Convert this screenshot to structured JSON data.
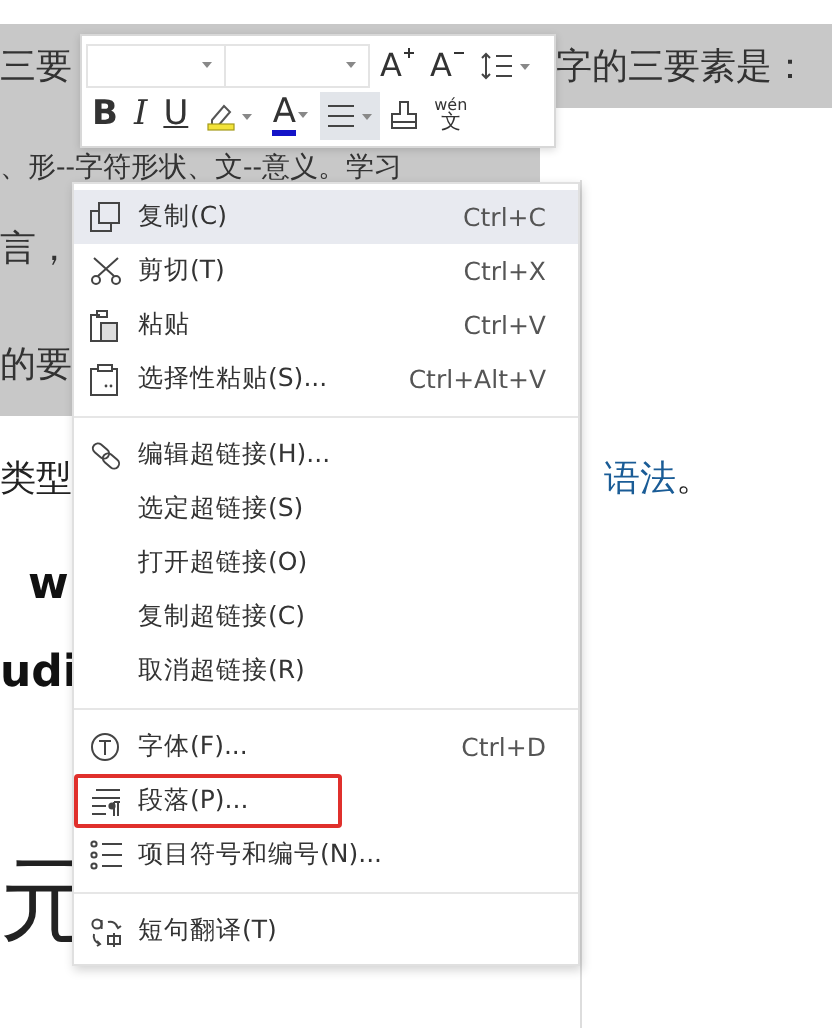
{
  "document": {
    "lines": [
      {
        "left": "三要",
        "right": "字的三要素是：",
        "highlighted": true
      },
      {
        "left": "、形--字符形状、文--意义。学习",
        "highlighted": true
      },
      {
        "left": "言，",
        "highlighted": true
      },
      {
        "left": "的要",
        "highlighted": true
      },
      {
        "left": "类型",
        "right": "语法",
        "right_tail": "。",
        "highlighted": false
      },
      {
        "left_tail": "w",
        "highlighted": false
      },
      {
        "left_tail": "udi",
        "highlighted": false
      },
      {
        "left": "元",
        "highlighted": false
      }
    ]
  },
  "toolbar": {
    "rows": [
      [
        {
          "kind": "font-name"
        },
        {
          "kind": "font-size"
        },
        {
          "kind": "grow",
          "glyph": "A"
        },
        {
          "kind": "shrink",
          "glyph": "A"
        },
        {
          "kind": "line-spacing"
        }
      ],
      [
        {
          "kind": "bold",
          "glyph": "B",
          "active": false
        },
        {
          "kind": "italic",
          "glyph": "I",
          "active": false
        },
        {
          "kind": "underline",
          "glyph": "U",
          "active": false
        },
        {
          "kind": "highlight",
          "active": false
        },
        {
          "kind": "font-color",
          "glyph": "A",
          "active": false
        },
        {
          "kind": "align",
          "active": true
        },
        {
          "kind": "format-painter",
          "active": false
        },
        {
          "kind": "pinyin",
          "glyph": "wén",
          "char": "文",
          "active": false
        }
      ]
    ]
  },
  "context_menu": {
    "groups": [
      [
        {
          "label": "复制(C)",
          "shortcut": "Ctrl+C",
          "selected": true,
          "highlighted": false
        },
        {
          "label": "剪切(T)",
          "shortcut": "Ctrl+X",
          "selected": false,
          "highlighted": false
        },
        {
          "label": "粘贴",
          "shortcut": "Ctrl+V",
          "selected": false,
          "highlighted": false
        },
        {
          "label": "选择性粘贴(S)...",
          "shortcut": "Ctrl+Alt+V",
          "selected": false,
          "highlighted": false
        }
      ],
      [
        {
          "label": "编辑超链接(H)...",
          "selected": false,
          "highlighted": false
        },
        {
          "label": "选定超链接(S)",
          "selected": false,
          "highlighted": false
        },
        {
          "label": "打开超链接(O)",
          "selected": false,
          "highlighted": false
        },
        {
          "label": "复制超链接(C)",
          "selected": false,
          "highlighted": false
        },
        {
          "label": "取消超链接(R)",
          "selected": false,
          "highlighted": false
        }
      ],
      [
        {
          "label": "字体(F)...",
          "shortcut": "Ctrl+D",
          "selected": false,
          "highlighted": false
        },
        {
          "label": "段落(P)...",
          "selected": false,
          "highlighted": true
        },
        {
          "label": "项目符号和编号(N)...",
          "selected": false,
          "highlighted": false
        }
      ],
      [
        {
          "label": "短句翻译(T)",
          "selected": false,
          "highlighted": false
        }
      ]
    ]
  }
}
